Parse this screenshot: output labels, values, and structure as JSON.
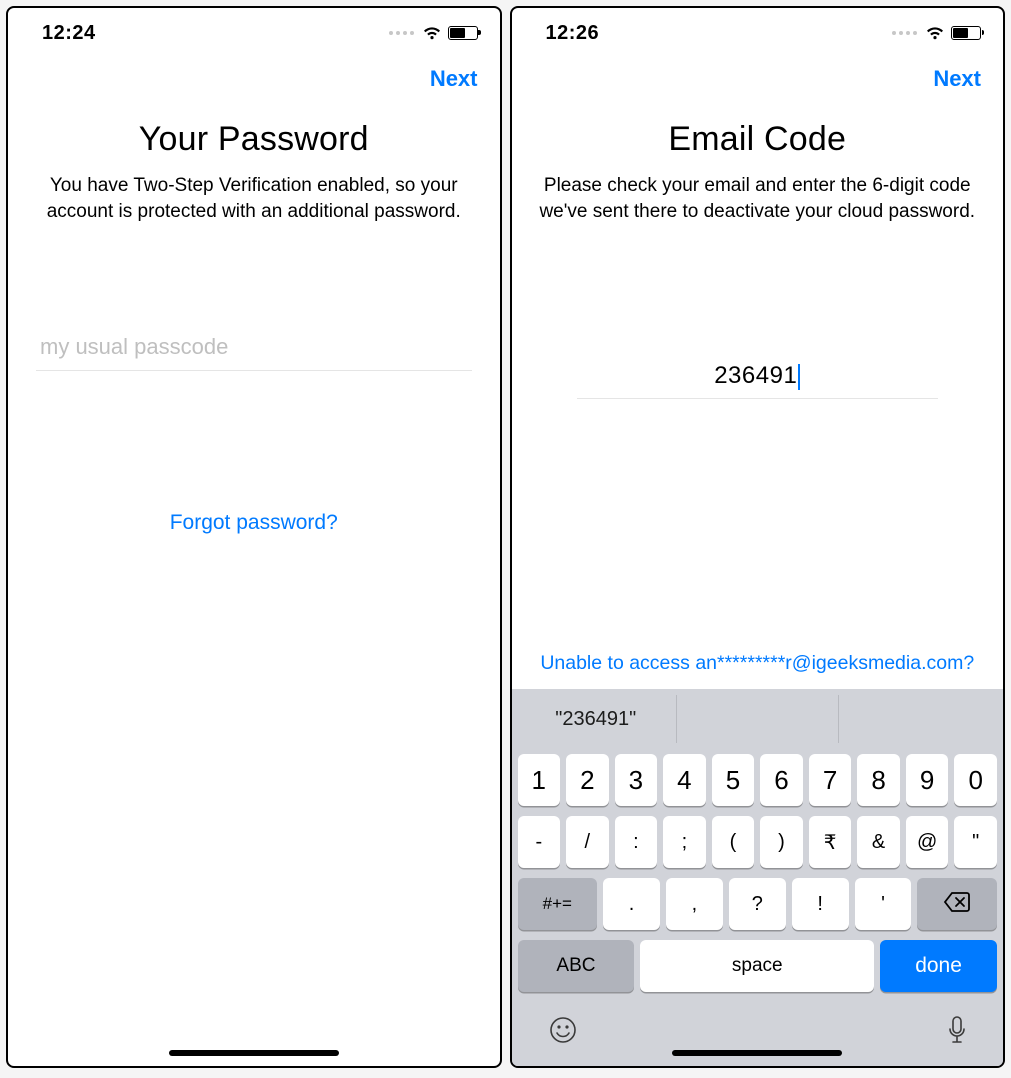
{
  "left": {
    "status": {
      "time": "12:24"
    },
    "nav": {
      "next": "Next"
    },
    "title": "Your Password",
    "subtitle": "You have Two-Step Verification enabled, so your account is protected with an additional password.",
    "input": {
      "placeholder": "my usual passcode",
      "value": ""
    },
    "forgot": "Forgot password?"
  },
  "right": {
    "status": {
      "time": "12:26"
    },
    "nav": {
      "next": "Next"
    },
    "title": "Email Code",
    "subtitle": "Please check your email and enter the 6-digit code we've sent there to deactivate your cloud password.",
    "code": {
      "value": "236491"
    },
    "unable": "Unable to access an*********r@igeeksmedia.com?",
    "keyboard": {
      "suggestion": "\"236491\"",
      "row1": [
        "1",
        "2",
        "3",
        "4",
        "5",
        "6",
        "7",
        "8",
        "9",
        "0"
      ],
      "row2": [
        "-",
        "/",
        ":",
        ";",
        "(",
        ")",
        "₹",
        "&",
        "@",
        "\""
      ],
      "row3_shift": "#+=",
      "row3": [
        ".",
        ",",
        "?",
        "!",
        "'"
      ],
      "abc": "ABC",
      "space": "space",
      "done": "done"
    }
  }
}
